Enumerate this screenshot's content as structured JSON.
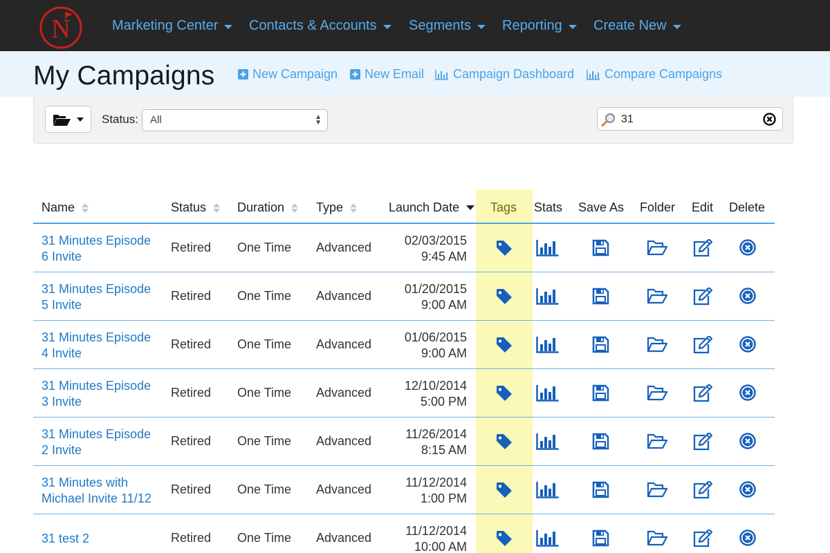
{
  "brand": {
    "logo_letter": "N"
  },
  "nav": {
    "items": [
      {
        "label": "Marketing Center"
      },
      {
        "label": "Contacts & Accounts"
      },
      {
        "label": "Segments"
      },
      {
        "label": "Reporting"
      },
      {
        "label": "Create New"
      }
    ]
  },
  "header": {
    "title": "My Campaigns",
    "links": [
      {
        "label": "New Campaign",
        "icon": "plus-square-icon"
      },
      {
        "label": "New Email",
        "icon": "plus-square-icon"
      },
      {
        "label": "Campaign Dashboard",
        "icon": "bar-chart-icon"
      },
      {
        "label": "Compare Campaigns",
        "icon": "bar-chart-icon"
      }
    ]
  },
  "filters": {
    "status_label": "Status:",
    "status_value": "All",
    "search_value": "31"
  },
  "table": {
    "columns": [
      "Name",
      "Status",
      "Duration",
      "Type",
      "Launch Date",
      "Tags",
      "Stats",
      "Save As",
      "Folder",
      "Edit",
      "Delete"
    ],
    "rows": [
      {
        "name": [
          "31 Minutes Episode",
          "6 Invite"
        ],
        "status": "Retired",
        "duration": "One Time",
        "type": "Advanced",
        "date": "02/03/2015",
        "time": "9:45 AM"
      },
      {
        "name": [
          "31 Minutes Episode",
          "5 Invite"
        ],
        "status": "Retired",
        "duration": "One Time",
        "type": "Advanced",
        "date": "01/20/2015",
        "time": "9:00 AM"
      },
      {
        "name": [
          "31 Minutes Episode",
          "4 Invite"
        ],
        "status": "Retired",
        "duration": "One Time",
        "type": "Advanced",
        "date": "01/06/2015",
        "time": "9:00 AM"
      },
      {
        "name": [
          "31 Minutes Episode",
          "3 Invite"
        ],
        "status": "Retired",
        "duration": "One Time",
        "type": "Advanced",
        "date": "12/10/2014",
        "time": "5:00 PM"
      },
      {
        "name": [
          "31 Minutes Episode",
          "2 Invite"
        ],
        "status": "Retired",
        "duration": "One Time",
        "type": "Advanced",
        "date": "11/26/2014",
        "time": "8:15 AM"
      },
      {
        "name": [
          "31 Minutes with",
          "Michael Invite 11/12"
        ],
        "status": "Retired",
        "duration": "One Time",
        "type": "Advanced",
        "date": "11/12/2014",
        "time": "1:00 PM"
      },
      {
        "name": [
          "31 test 2"
        ],
        "status": "Retired",
        "duration": "One Time",
        "type": "Advanced",
        "date": "11/12/2014",
        "time": "10:00 AM"
      }
    ]
  },
  "colors": {
    "nav_bg": "#262626",
    "nav_link": "#55acee",
    "header_bg": "#eaf4fc",
    "link": "#1f7ac7",
    "icon": "#1560bd",
    "tags_highlight": "#fbf9b7",
    "logo_red": "#c8211b"
  }
}
